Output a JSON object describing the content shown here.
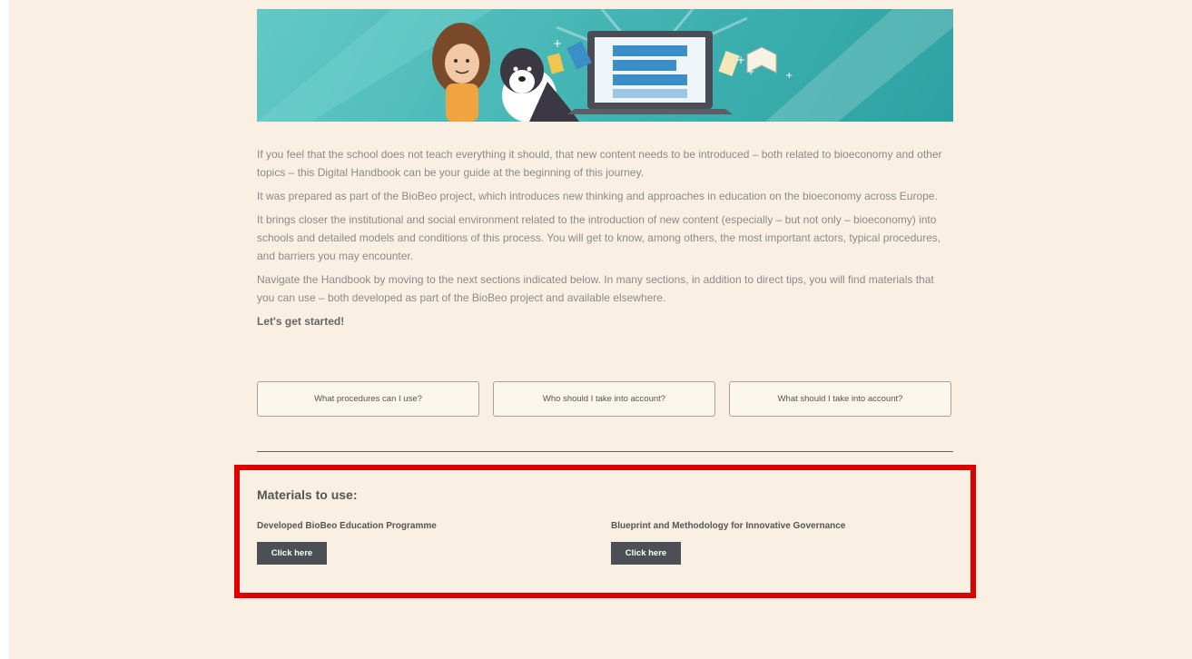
{
  "intro": {
    "paragraphs": [
      "If you feel that the school does not teach everything it should, that new content needs to be introduced – both related to bioeconomy and other topics – this Digital Handbook can be your guide at the beginning of this journey.",
      "It was prepared as part of the BioBeo project, which introduces new thinking and approaches in education on the bioeconomy across Europe.",
      "It brings closer the institutional and social environment related to the introduction of new content (especially – but not only – bioeconomy) into schools and detailed models and conditions of this process. You will get to know, among others, the most important actors, typical procedures, and barriers you may encounter.",
      "Navigate the Handbook by moving to the next sections indicated below. In many sections, in addition to direct tips, you will find materials that you can use – both developed as part of the BioBeo project and available elsewhere."
    ],
    "cta": "Let's get started!"
  },
  "nav_buttons": [
    "What procedures can I use?",
    "Who should I take into account?",
    "What should I take into account?"
  ],
  "materials": {
    "title": "Materials to use:",
    "items": [
      {
        "title": "Developed BioBeo Education Programme",
        "button": "Click here"
      },
      {
        "title": "Blueprint and Methodology for Innovative Governance",
        "button": "Click here"
      }
    ]
  },
  "colors": {
    "page_bg": "#f9f0e3",
    "banner": "#3fb2b1",
    "button_dark": "#4d4f57",
    "highlight": "#e00000"
  },
  "icons": [
    "girl-illustration",
    "dog-illustration",
    "laptop-icon",
    "book-icon",
    "sparkle-icon"
  ]
}
